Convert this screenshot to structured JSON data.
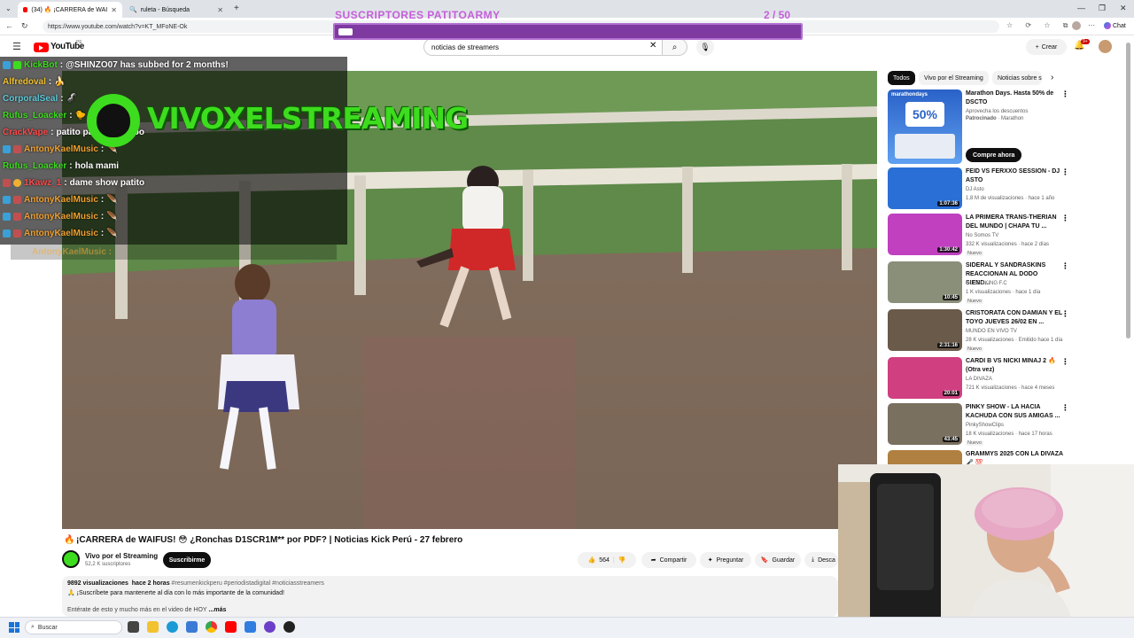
{
  "browser": {
    "tabs": [
      {
        "label": "(34) 🔥 ¡CARRERA de WAIFUS! 😳 ¿R...",
        "active": true
      },
      {
        "label": "ruleta - Búsqueda",
        "active": false
      }
    ],
    "new_tab": "+",
    "url": "https://www.youtube.com/watch?v=KT_MFoNE-Ok",
    "chat_label": "Chat",
    "window_controls": [
      "—",
      "❐",
      "✕"
    ]
  },
  "youtube": {
    "logo_text": "YouTube",
    "logo_country": "PE",
    "search_value": "noticias de streamers",
    "create_label": "Crear",
    "notif_count": "9+"
  },
  "overlay": {
    "sub_goal_title": "SUSCRIPTORES PATITOARMY",
    "sub_goal_count": "2  / 50",
    "banner_text": "VIVOXELSTREAMING",
    "chat": [
      {
        "user": "KickBot",
        "color": "#3ddc1e",
        "message": "@SHINZO07 has subbed for 2 months!"
      },
      {
        "user": "Alfredoval",
        "color": "#f0c030",
        "message": "🍌"
      },
      {
        "user": "CorporalSeal",
        "color": "#5ec8d8",
        "message": "🦨"
      },
      {
        "user": "Rufus_Loacker",
        "color": "#3ddc1e",
        "message": "🐤"
      },
      {
        "user": "CrackVape",
        "color": "#ff4a4a",
        "message": "patito patito patitooo"
      },
      {
        "user": "AntonyKaelMusic",
        "color": "#f0a030",
        "message": "🪶"
      },
      {
        "user": "Rufus_Loacker",
        "color": "#3ddc1e",
        "message": "hola mami"
      },
      {
        "user": "1Kawz_1",
        "color": "#ff4a4a",
        "message": "dame show patito"
      },
      {
        "user": "AntonyKaelMusic",
        "color": "#f0a030",
        "message": "🪶"
      },
      {
        "user": "AntonyKaelMusic",
        "color": "#f0a030",
        "message": "🪶"
      },
      {
        "user": "AntonyKaelMusic",
        "color": "#f0a030",
        "message": "🪶"
      }
    ],
    "chat_ghost": "AntonyKaelMusic :"
  },
  "video": {
    "title": "¡CARRERA de WAIFUS! 😳 ¿Ronchas D1SCR1M** por PDF? | Noticias Kick Perú - 27 febrero",
    "channel": "Vivo por el Streaming",
    "subscribers": "52,2 K suscriptores",
    "subscribe_label": "Suscribirme",
    "likes": "564",
    "share_label": "Compartir",
    "ask_label": "Preguntar",
    "save_label": "Guardar",
    "download_label": "Desca",
    "views": "9892 visualizaciones",
    "posted": "hace 2 horas",
    "hashtags": "#resumenkickperu #periodistadigital #noticiasstreamers",
    "desc_line1": "🙏 ¡Suscríbete para mantenerte al día con lo más importante de la comunidad!",
    "desc_line2": "Entérate de esto y mucho más en el video de HOY",
    "more_label": "...más"
  },
  "sidebar": {
    "chips": [
      "Todos",
      "Vivo por el Streaming",
      "Noticias sobre s"
    ],
    "ad": {
      "title": "Marathon Days. Hasta 50% de DSCTO",
      "subtitle": "Aprovecha los descuentos",
      "sponsored": "Patrocinado",
      "advertiser": "Marathon",
      "cta": "Compre ahora",
      "thumb_brand": "marathondays",
      "thumb_percent": "50%"
    },
    "recommendations": [
      {
        "title": "FEID VS FERXXO SESSION - DJ ASTO",
        "channel": "DJ Asto",
        "meta": "1,8 M de visualizaciones · hace 1 año",
        "duration": "1:07:36",
        "badge": "",
        "thumb_color": "#2a6fd6"
      },
      {
        "title": "LA PRIMERA TRANS-THERIAN DEL MUNDO | CHAPA TU ...",
        "channel": "No Somos TV",
        "meta": "332 K visualizaciones · hace 2 días",
        "duration": "1:30:42",
        "badge": "Nuevo",
        "thumb_color": "#c040c0"
      },
      {
        "title": "SIDERAL Y SANDRASKINS REACCIONAN AL DODO SIEND...",
        "channel": "GLOBOKING F.C",
        "meta": "1 K visualizaciones · hace 1 día",
        "duration": "10:45",
        "badge": "Nuevo",
        "thumb_color": "#8a8f7a"
      },
      {
        "title": "CRISTORATA CON DAMIAN Y EL TOYO JUEVES 26/02 EN ...",
        "channel": "MUNDO EN VIVO TV",
        "meta": "28 K visualizaciones · Emitido hace 1 día",
        "duration": "2:31:16",
        "badge": "Nuevo",
        "thumb_color": "#6a5a4a"
      },
      {
        "title": "CARDI B VS NICKI MINAJ 2 🔥 (Otra vez)",
        "channel": "LA DIVAZA",
        "meta": "721 K visualizaciones · hace 4 meses",
        "duration": "20:01",
        "badge": "",
        "thumb_color": "#d04080"
      },
      {
        "title": "PINKY SHOW - LA HACIA KACHUDA CON SUS AMIGAS ...",
        "channel": "PinkyShowClips",
        "meta": "18 K visualizaciones · hace 17 horas",
        "duration": "43:45",
        "badge": "Nuevo",
        "thumb_color": "#7a7060"
      },
      {
        "title": "GRAMMYS 2025 CON LA DIVAZA 🎤 💯",
        "channel": "",
        "meta": "",
        "duration": "",
        "badge": "",
        "thumb_color": "#b08040"
      }
    ]
  },
  "taskbar": {
    "search_label": "Buscar"
  }
}
